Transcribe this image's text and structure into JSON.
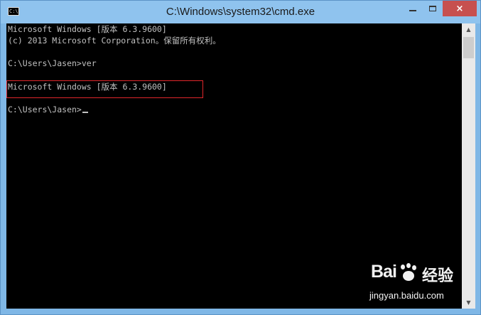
{
  "window": {
    "title": "C:\\Windows\\system32\\cmd.exe",
    "icon_label": "C:\\",
    "controls": {
      "minimize": "minimize-icon",
      "maximize": "maximize-icon",
      "close": "×"
    }
  },
  "console": {
    "lines": [
      "Microsoft Windows [版本 6.3.9600]",
      "(c) 2013 Microsoft Corporation。保留所有权利。",
      "",
      "C:\\Users\\Jasen>ver",
      "",
      "Microsoft Windows [版本 6.3.9600]",
      "",
      "C:\\Users\\Jasen>"
    ],
    "highlight_color": "#e0262b"
  },
  "scrollbar": {
    "up": "▲",
    "down": "▼"
  },
  "watermark": {
    "logo": "Bai",
    "name": "经验",
    "url": "jingyan.baidu.com"
  }
}
